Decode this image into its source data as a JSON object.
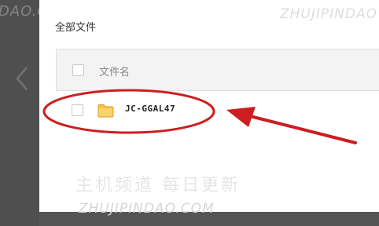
{
  "breadcrumb": {
    "title": "全部文件"
  },
  "file_list": {
    "header": {
      "name_column_label": "文件名"
    },
    "items": [
      {
        "name": "JC-GGAL47",
        "icon": "folder-icon",
        "selected": false
      }
    ]
  },
  "annotation": {
    "color": "#cc1f1f"
  },
  "watermarks": {
    "top_left": "DAO.COM",
    "top_right": "ZHUJIPINDAO",
    "center_cn": "主机频道 每日更新",
    "bottom": "ZHUJIPINDAO.COM"
  },
  "colors": {
    "background": "#555555",
    "panel": "#ffffff",
    "header_row": "#f3f3f3",
    "folder": "#f5c04a"
  }
}
